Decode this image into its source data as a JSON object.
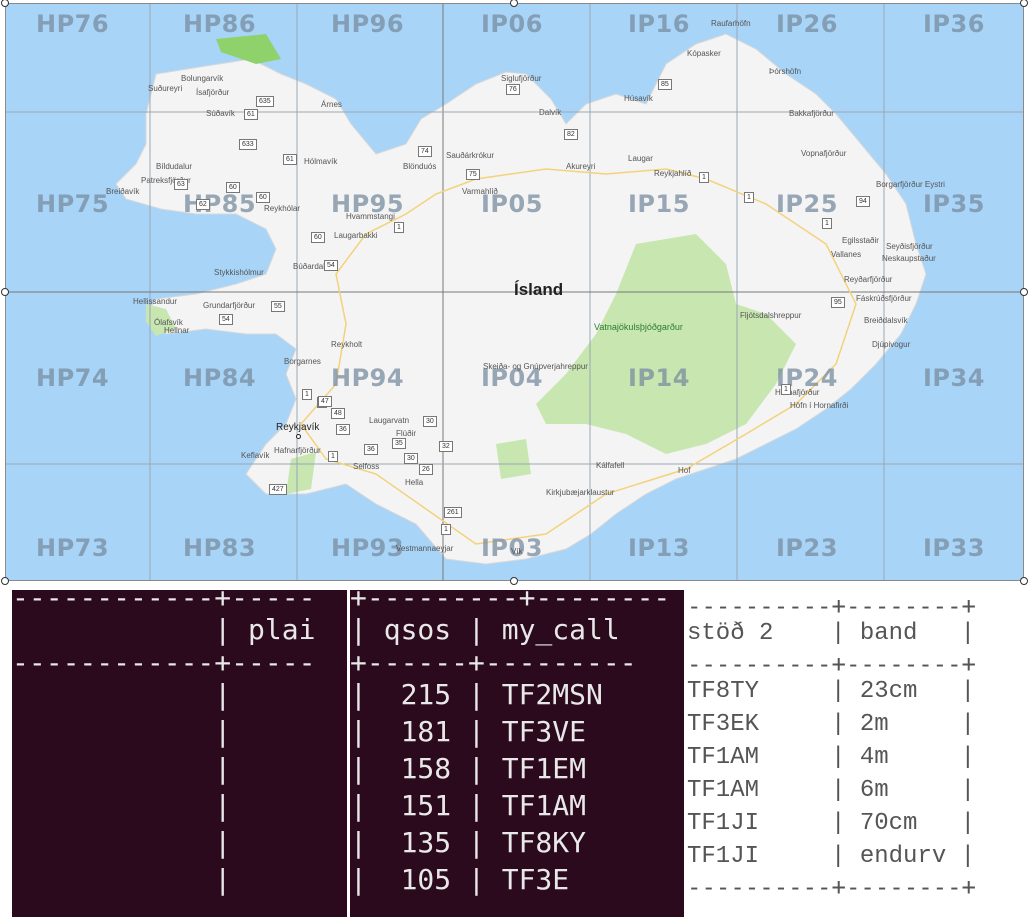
{
  "map": {
    "country_label": "Ísland",
    "park_label": "Vatnajökulsþjóðgarður",
    "capital_label": "Reykjavík",
    "grid_labels": [
      {
        "id": "HP76",
        "row": 0,
        "col": 0
      },
      {
        "id": "HP86",
        "row": 0,
        "col": 1
      },
      {
        "id": "HP96",
        "row": 0,
        "col": 2
      },
      {
        "id": "IP06",
        "row": 0,
        "col": 3
      },
      {
        "id": "IP16",
        "row": 0,
        "col": 4
      },
      {
        "id": "IP26",
        "row": 0,
        "col": 5
      },
      {
        "id": "IP36",
        "row": 0,
        "col": 6
      },
      {
        "id": "HP75",
        "row": 1,
        "col": 0
      },
      {
        "id": "HP85",
        "row": 1,
        "col": 1
      },
      {
        "id": "HP95",
        "row": 1,
        "col": 2
      },
      {
        "id": "IP05",
        "row": 1,
        "col": 3
      },
      {
        "id": "IP15",
        "row": 1,
        "col": 4
      },
      {
        "id": "IP25",
        "row": 1,
        "col": 5
      },
      {
        "id": "IP35",
        "row": 1,
        "col": 6
      },
      {
        "id": "HP74",
        "row": 2,
        "col": 0
      },
      {
        "id": "HP84",
        "row": 2,
        "col": 1
      },
      {
        "id": "HP94",
        "row": 2,
        "col": 2
      },
      {
        "id": "IP04",
        "row": 2,
        "col": 3
      },
      {
        "id": "IP14",
        "row": 2,
        "col": 4
      },
      {
        "id": "IP24",
        "row": 2,
        "col": 5
      },
      {
        "id": "IP34",
        "row": 2,
        "col": 6
      },
      {
        "id": "HP73",
        "row": 3,
        "col": 0
      },
      {
        "id": "HP83",
        "row": 3,
        "col": 1
      },
      {
        "id": "HP93",
        "row": 3,
        "col": 2
      },
      {
        "id": "IP03",
        "row": 3,
        "col": 3
      },
      {
        "id": "IP13",
        "row": 3,
        "col": 4
      },
      {
        "id": "IP23",
        "row": 3,
        "col": 5
      },
      {
        "id": "IP33",
        "row": 3,
        "col": 6
      }
    ],
    "places": [
      "Raufarhöfn",
      "Kópasker",
      "Þórshöfn",
      "Húsavík",
      "Siglufjörður",
      "Dalvík",
      "Bakkafjörður",
      "Vopnafjörður",
      "Bolungarvík",
      "Suðureyri",
      "Ísafjörður",
      "Súðavík",
      "Árnes",
      "Hólmavík",
      "Bíldudalur",
      "Patreksfjörður",
      "Breiðavík",
      "Reykhólar",
      "Blönduós",
      "Sauðárkrókur",
      "Varmahlíð",
      "Akureyri",
      "Laugar",
      "Reykjahlíð",
      "Hvammstangi",
      "Laugarbakki",
      "Búðardalur",
      "Stykkishólmur",
      "Hellissandur",
      "Grundarfjörður",
      "Ólafsvík",
      "Hellnar",
      "Borgarnes",
      "Reykholt",
      "Skeiða- og Gnúpverjahreppur",
      "Borgarfjörður Eystri",
      "Egilsstaðir",
      "Seyðisfjörður",
      "Vallanes",
      "Neskaupstaður",
      "Reyðarfjörður",
      "Fáskrúðsfjörður",
      "Fljótsdalshreppur",
      "Breiðdalsvík",
      "Djúpivogur",
      "Hornafjörður",
      "Höfn í Hornafirði",
      "Laugarvatn",
      "Flúðir",
      "Keflavík",
      "Hafnarfjörður",
      "Selfoss",
      "Hella",
      "Kálfafell",
      "Hof",
      "Kirkjubæjarklaustur",
      "Vestmannaeyjar",
      "Vík"
    ],
    "roads": [
      "635",
      "61",
      "633",
      "61",
      "63",
      "60",
      "62",
      "60",
      "76",
      "82",
      "85",
      "74",
      "75",
      "1",
      "1",
      "1",
      "60",
      "54",
      "55",
      "54",
      "94",
      "1",
      "95",
      "1",
      "1",
      "47",
      "48",
      "36",
      "30",
      "35",
      "32",
      "36",
      "30",
      "26",
      "1",
      "427",
      "261",
      "1",
      "1"
    ]
  },
  "table1": {
    "lines": [
      "------------+-----",
      "            | plai",
      "------------+-----",
      "            |",
      "            |",
      "            |",
      "            |",
      "            |",
      "            |"
    ]
  },
  "table2": {
    "lines": [
      "+---------+--------",
      "| qsos | my_call",
      "+------+---------",
      "|  215 | TF2MSN",
      "|  181 | TF3VE",
      "|  158 | TF1EM",
      "|  151 | TF1AM",
      "|  135 | TF8KY",
      "|  105 | TF3E"
    ]
  },
  "table3": {
    "lines": [
      "----------+--------+",
      "stöð 2    | band   |",
      "----------+--------+",
      "TF8TY     | 23cm   |",
      "TF3EK     | 2m     |",
      "TF1AM     | 4m     |",
      "TF1AM     | 6m     |",
      "TF1JI     | 70cm   |",
      "TF1JI     | endurv |",
      "----------+--------+"
    ]
  }
}
